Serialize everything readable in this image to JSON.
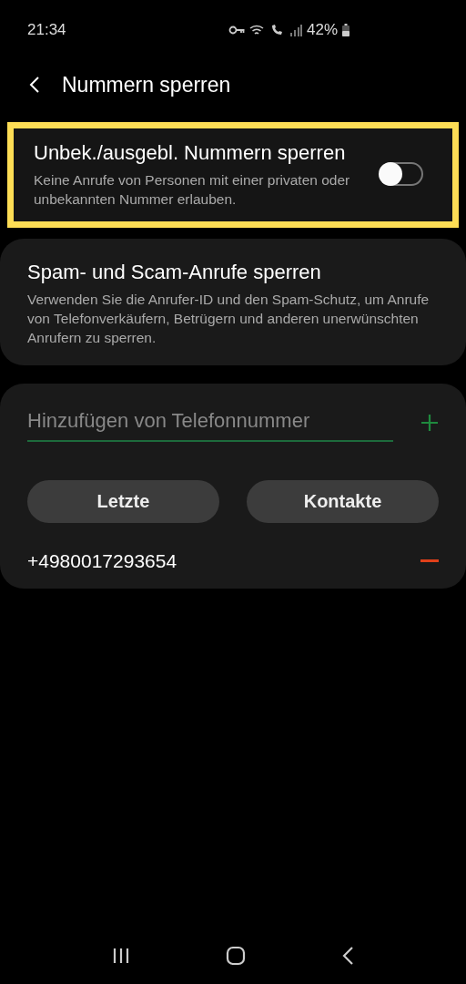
{
  "status_bar": {
    "time": "21:34",
    "battery": "42%"
  },
  "header": {
    "title": "Nummern sperren"
  },
  "settings": [
    {
      "title": "Unbek./ausgebl. Nummern sperren",
      "description": "Keine Anrufe von Personen mit einer privaten oder unbekannten Nummer erlauben.",
      "kind": "toggle",
      "on": false,
      "highlighted": true
    },
    {
      "title": "Spam- und Scam-Anrufe sperren",
      "description": "Verwenden Sie die Anrufer-ID und den Spam-Schutz, um Anrufe von Telefonverkäufern, Betrügern und anderen unerwünschten Anrufern zu sperren.",
      "kind": "plain",
      "highlighted": false
    }
  ],
  "add_number": {
    "placeholder": "Hinzufügen von Telefonnummer"
  },
  "buttons": [
    "Letzte",
    "Kontakte"
  ],
  "blocked_numbers": [
    {
      "number": "+4980017293654"
    }
  ]
}
